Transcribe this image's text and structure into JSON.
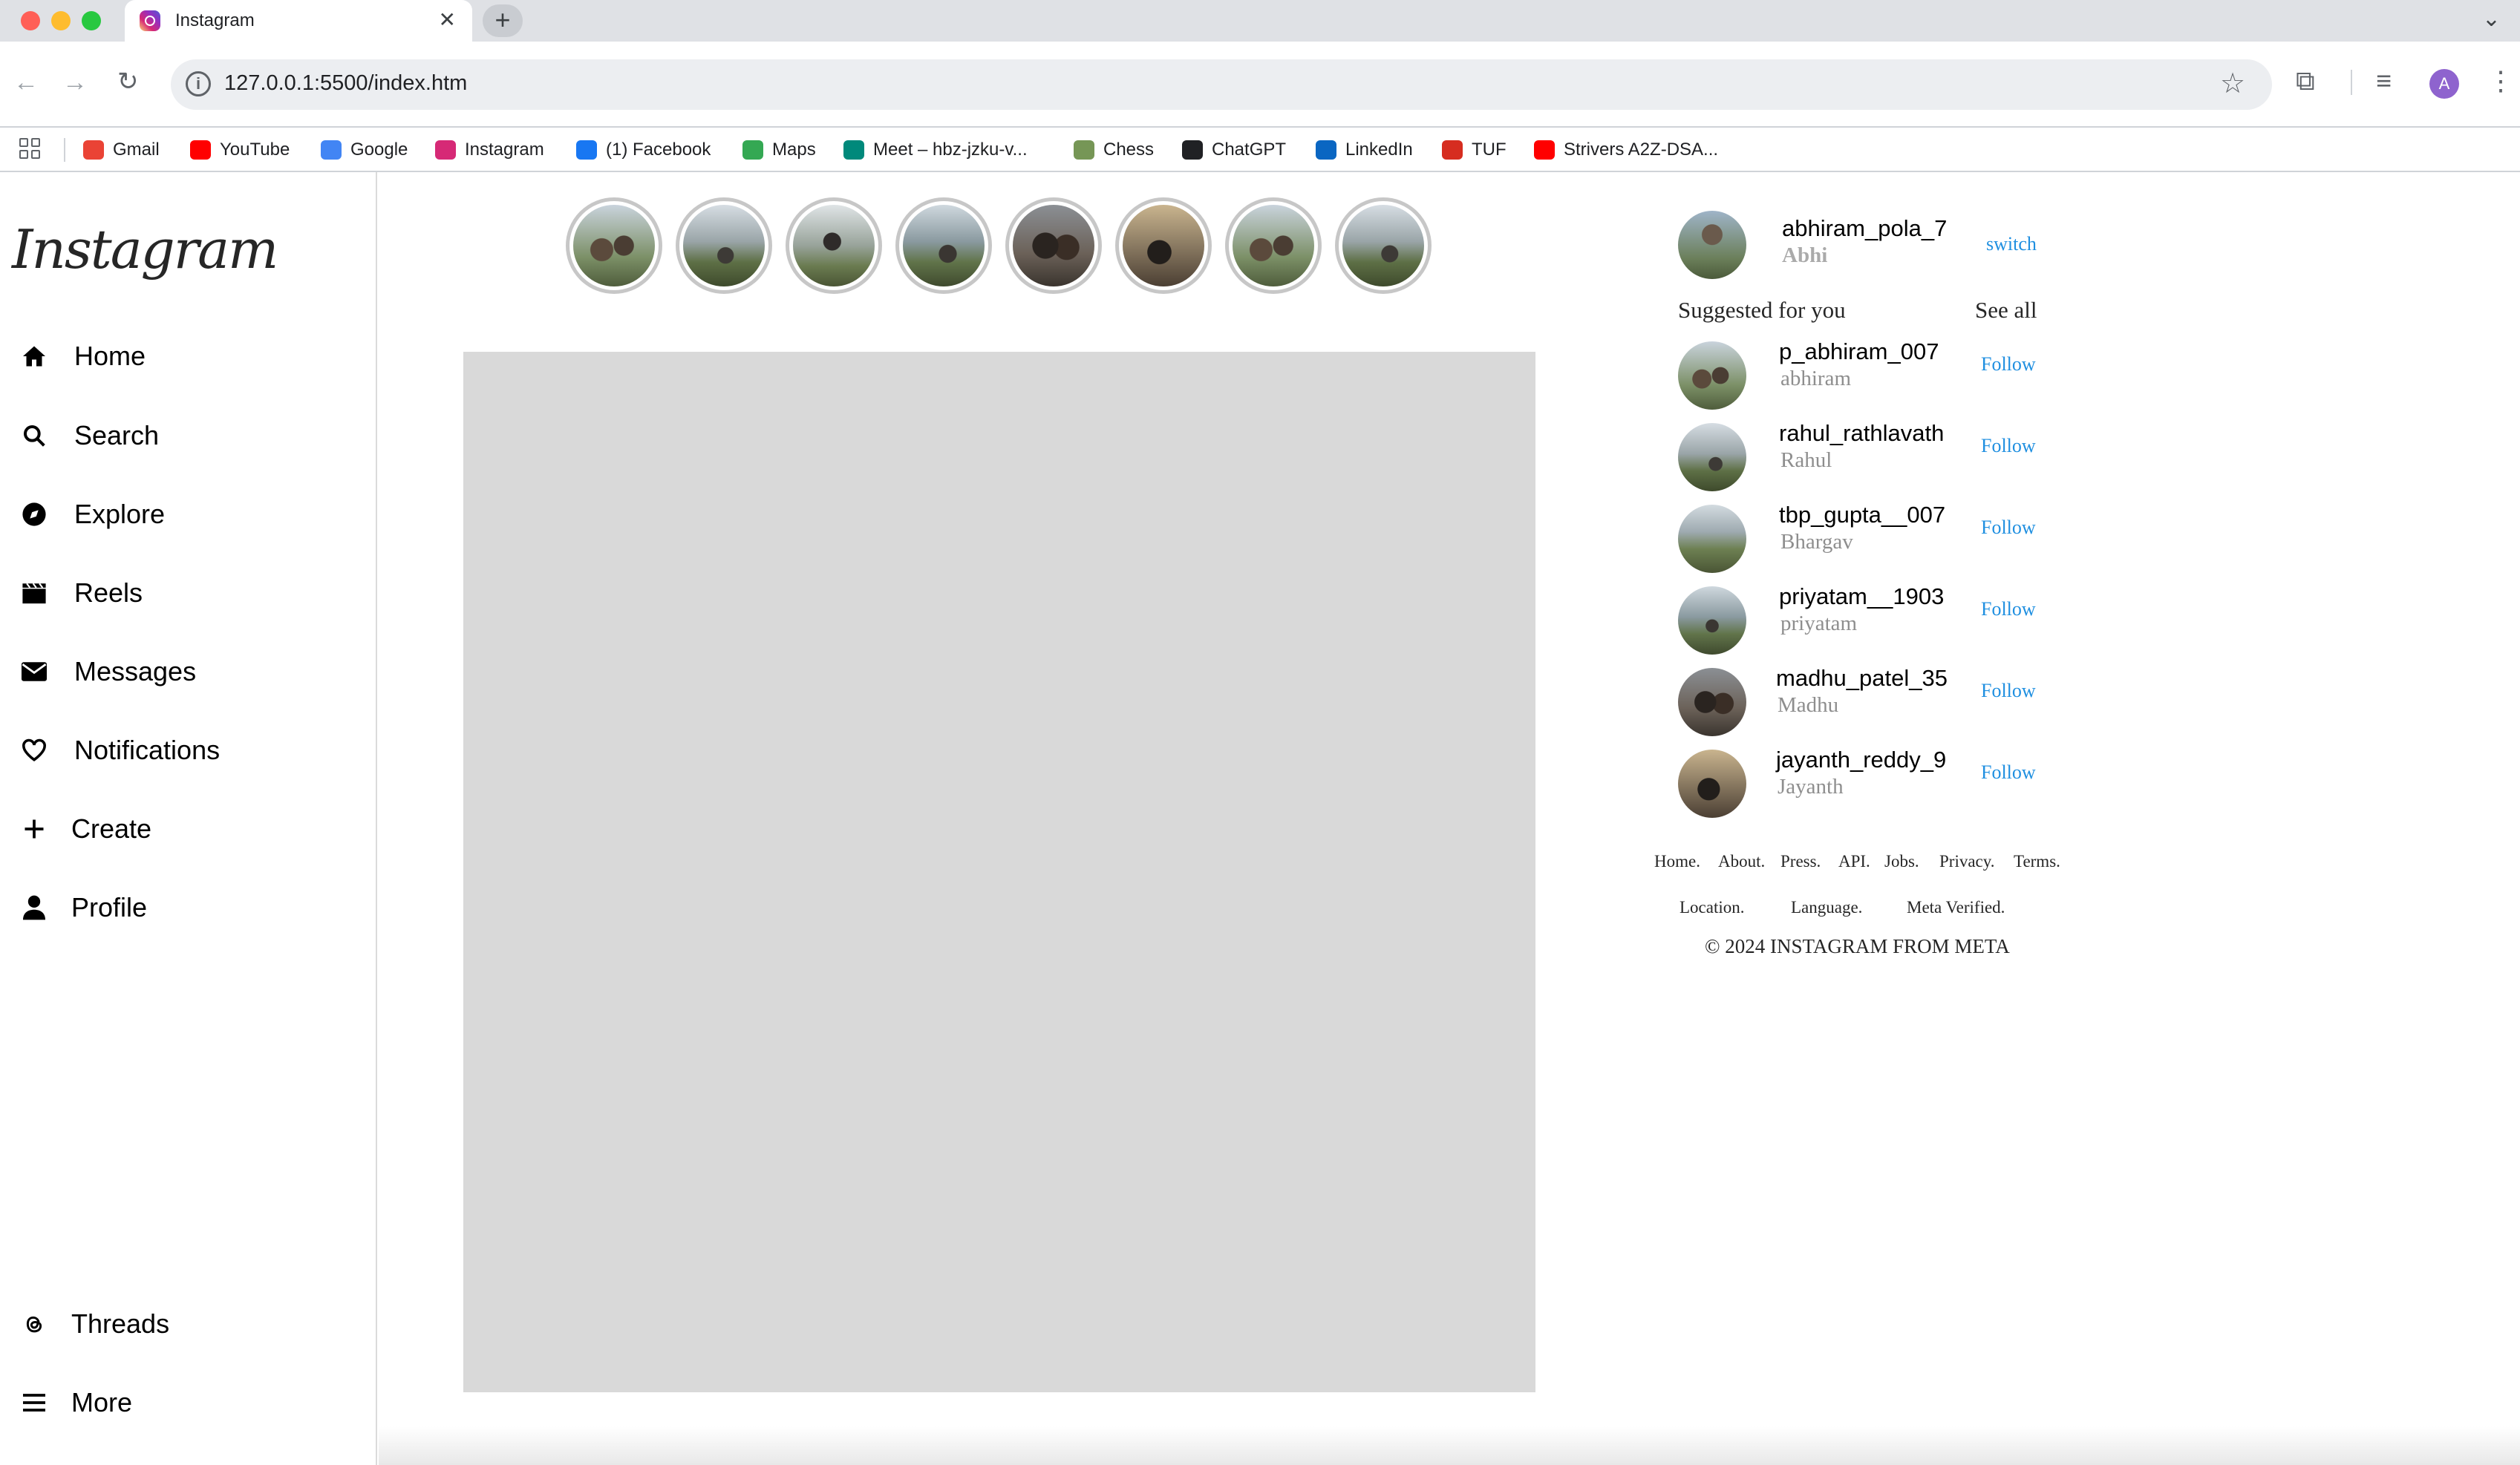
{
  "browser": {
    "tab_title": "Instagram",
    "url": "127.0.0.1:5500/index.htm",
    "profile_initial": "A",
    "bookmarks": [
      {
        "label": "Gmail",
        "icon": "gmail-icon",
        "color": "#ea4335"
      },
      {
        "label": "YouTube",
        "icon": "youtube-icon",
        "color": "#ff0000"
      },
      {
        "label": "Google",
        "icon": "google-icon",
        "color": "#4285f4"
      },
      {
        "label": "Instagram",
        "icon": "instagram-icon",
        "color": "#d62976"
      },
      {
        "label": "(1) Facebook",
        "icon": "facebook-icon",
        "color": "#1877f2"
      },
      {
        "label": "Maps",
        "icon": "maps-icon",
        "color": "#34a853"
      },
      {
        "label": "Meet – hbz-jzku-v...",
        "icon": "meet-icon",
        "color": "#00897b"
      },
      {
        "label": "Chess",
        "icon": "chess-icon",
        "color": "#769656"
      },
      {
        "label": "ChatGPT",
        "icon": "chatgpt-icon",
        "color": "#202124"
      },
      {
        "label": "LinkedIn",
        "icon": "linkedin-icon",
        "color": "#0a66c2"
      },
      {
        "label": "TUF",
        "icon": "tuf-icon",
        "color": "#d62d20"
      },
      {
        "label": "Strivers A2Z-DSA...",
        "icon": "youtube-icon",
        "color": "#ff0000"
      }
    ]
  },
  "sidebar": {
    "logo": "Instagram",
    "items": [
      {
        "label": "Home",
        "icon": "home-icon"
      },
      {
        "label": "Search",
        "icon": "search-icon"
      },
      {
        "label": "Explore",
        "icon": "compass-icon"
      },
      {
        "label": "Reels",
        "icon": "clapperboard-icon"
      },
      {
        "label": "Messages",
        "icon": "envelope-icon"
      },
      {
        "label": "Notifications",
        "icon": "heart-icon"
      },
      {
        "label": "Create",
        "icon": "plus-icon"
      },
      {
        "label": "Profile",
        "icon": "user-icon"
      }
    ],
    "bottom_items": [
      {
        "label": "Threads",
        "icon": "threads-icon"
      },
      {
        "label": "More",
        "icon": "menu-icon"
      }
    ]
  },
  "stories_count": 8,
  "account": {
    "username": "abhiram_pola_7",
    "name": "Abhi",
    "switch_label": "switch"
  },
  "suggestions": {
    "title": "Suggested for you",
    "see_all": "See all",
    "follow_label": "Follow",
    "users": [
      {
        "username": "p_abhiram_007",
        "name": "abhiram"
      },
      {
        "username": "rahul_rathlavath",
        "name": "Rahul"
      },
      {
        "username": "tbp_gupta__007",
        "name": "Bhargav"
      },
      {
        "username": "priyatam__1903",
        "name": "priyatam"
      },
      {
        "username": "madhu_patel_35",
        "name": "Madhu"
      },
      {
        "username": "jayanth_reddy_9",
        "name": "Jayanth"
      }
    ]
  },
  "footer": {
    "links_row1": [
      "Home.",
      "About.",
      "Press.",
      "API.",
      "Jobs.",
      "Privacy.",
      "Terms."
    ],
    "links_row2": [
      "Location.",
      "Language.",
      "Meta Verified."
    ],
    "copyright": "© 2024 INSTAGRAM FROM META"
  },
  "colors": {
    "link_blue": "#1f8fe0",
    "post_placeholder": "#d9d9d9",
    "story_ring": "#c7c7c7"
  }
}
